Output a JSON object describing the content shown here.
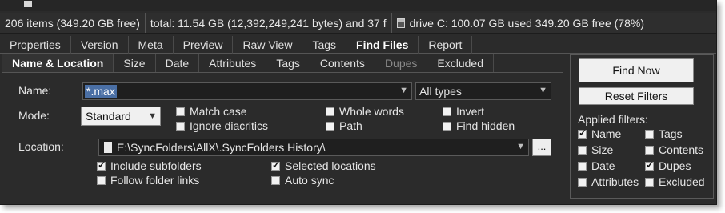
{
  "status": {
    "items": "206 items (349.20 GB free)",
    "total": "total: 11.54 GB (12,392,249,241 bytes) and 37 f",
    "drive": "drive C:  100.07 GB used   349.20 GB free (78%)"
  },
  "main_tabs": [
    {
      "label": "Properties",
      "active": false
    },
    {
      "label": "Version",
      "active": false
    },
    {
      "label": "Meta",
      "active": false
    },
    {
      "label": "Preview",
      "active": false
    },
    {
      "label": "Raw View",
      "active": false
    },
    {
      "label": "Tags",
      "active": false
    },
    {
      "label": "Find Files",
      "active": true
    },
    {
      "label": "Report",
      "active": false
    }
  ],
  "sub_tabs": [
    {
      "label": "Name & Location",
      "state": "active"
    },
    {
      "label": "Size",
      "state": "normal"
    },
    {
      "label": "Date",
      "state": "normal"
    },
    {
      "label": "Attributes",
      "state": "normal"
    },
    {
      "label": "Tags",
      "state": "normal"
    },
    {
      "label": "Contents",
      "state": "normal"
    },
    {
      "label": "Dupes",
      "state": "disabled"
    },
    {
      "label": "Excluded",
      "state": "normal"
    }
  ],
  "form": {
    "name_label": "Name:",
    "name_value": "*.max",
    "types_value": "All types",
    "mode_label": "Mode:",
    "mode_value": "Standard",
    "location_label": "Location:",
    "location_value": "E:\\SyncFolders\\AllX\\.SyncFolders History\\",
    "browse_label": "..."
  },
  "options": {
    "match_case": {
      "label": "Match case",
      "checked": false
    },
    "ignore_diacritics": {
      "label": "Ignore diacritics",
      "checked": false
    },
    "whole_words": {
      "label": "Whole words",
      "checked": false
    },
    "path": {
      "label": "Path",
      "checked": false
    },
    "invert": {
      "label": "Invert",
      "checked": false
    },
    "find_hidden": {
      "label": "Find hidden",
      "checked": false
    },
    "include_subfolders": {
      "label": "Include subfolders",
      "checked": true
    },
    "follow_folder_links": {
      "label": "Follow folder links",
      "checked": false
    },
    "selected_locations": {
      "label": "Selected locations",
      "checked": true
    },
    "auto_sync": {
      "label": "Auto sync",
      "checked": false
    }
  },
  "actions": {
    "find_now": "Find Now",
    "reset_filters": "Reset Filters"
  },
  "applied_filters": {
    "title": "Applied filters:",
    "items": [
      {
        "label": "Name",
        "checked": true
      },
      {
        "label": "Tags",
        "checked": false
      },
      {
        "label": "Size",
        "checked": false
      },
      {
        "label": "Contents",
        "checked": false
      },
      {
        "label": "Date",
        "checked": false
      },
      {
        "label": "Dupes",
        "checked": true
      },
      {
        "label": "Attributes",
        "checked": false
      },
      {
        "label": "Excluded",
        "checked": false
      }
    ]
  }
}
